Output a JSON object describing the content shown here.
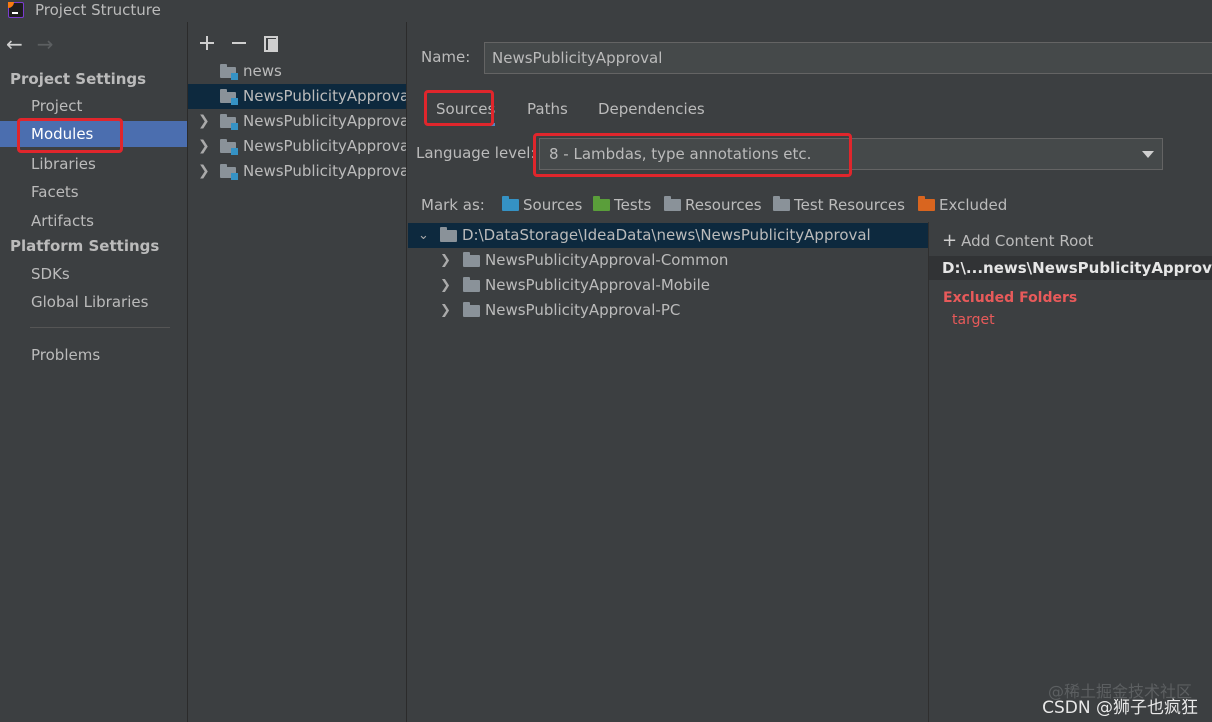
{
  "window": {
    "title": "Project Structure"
  },
  "sidebar": {
    "back_arrow": "←",
    "forward_arrow": "→",
    "project_settings_header": "Project Settings",
    "project_items": [
      "Project",
      "Modules",
      "Libraries",
      "Facets",
      "Artifacts"
    ],
    "selected_item": "Modules",
    "platform_settings_header": "Platform Settings",
    "platform_items": [
      "SDKs",
      "Global Libraries"
    ],
    "problems_label": "Problems"
  },
  "modules": {
    "toolbar": [
      "add-icon",
      "remove-icon",
      "copy-icon"
    ],
    "items": [
      {
        "label": "news",
        "expandable": false,
        "selected": false
      },
      {
        "label": "NewsPublicityApproval",
        "expandable": false,
        "selected": true
      },
      {
        "label": "NewsPublicityApproval",
        "expandable": true,
        "selected": false
      },
      {
        "label": "NewsPublicityApproval",
        "expandable": true,
        "selected": false
      },
      {
        "label": "NewsPublicityApproval",
        "expandable": true,
        "selected": false
      }
    ]
  },
  "details": {
    "name_label": "Name:",
    "name_value": "NewsPublicityApproval",
    "tabs": [
      "Sources",
      "Paths",
      "Dependencies"
    ],
    "active_tab": "Sources",
    "language_level_label": "Language level:",
    "language_level_value": "8 - Lambdas, type annotations etc.",
    "mark_as_label": "Mark as:",
    "mark_as": [
      {
        "label": "Sources",
        "color": "#3592c4"
      },
      {
        "label": "Tests",
        "color": "#5a9e3a"
      },
      {
        "label": "Resources",
        "color": "#8a9299"
      },
      {
        "label": "Test Resources",
        "color": "#8a9299"
      },
      {
        "label": "Excluded",
        "color": "#d9651f"
      }
    ],
    "tree": {
      "root": "D:\\DataStorage\\IdeaData\\news\\NewsPublicityApproval",
      "children": [
        "NewsPublicityApproval-Common",
        "NewsPublicityApproval-Mobile",
        "NewsPublicityApproval-PC"
      ]
    },
    "roots_panel": {
      "add_content_root": "Add Content Root",
      "root_path": "D:\\...news\\NewsPublicityApproval",
      "excluded_header": "Excluded Folders",
      "excluded_items": [
        "target"
      ]
    }
  },
  "watermark": {
    "line1": "@稀土掘金技术社区",
    "line2": "CSDN @狮子也疯狂"
  }
}
